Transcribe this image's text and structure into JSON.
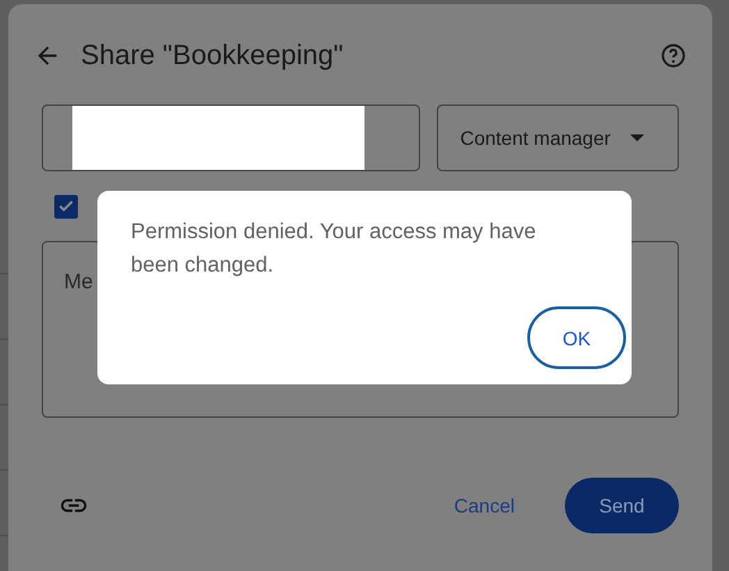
{
  "dialog": {
    "title": "Share \"Bookkeeping\"",
    "role_dropdown": {
      "value": "Content manager"
    },
    "notify_checkbox": {
      "checked": true
    },
    "message_field": {
      "placeholder": "Me"
    },
    "buttons": [
      "Cancel",
      "Send"
    ]
  },
  "alert": {
    "message": "Permission denied. Your access may have been changed.",
    "button": "OK"
  }
}
